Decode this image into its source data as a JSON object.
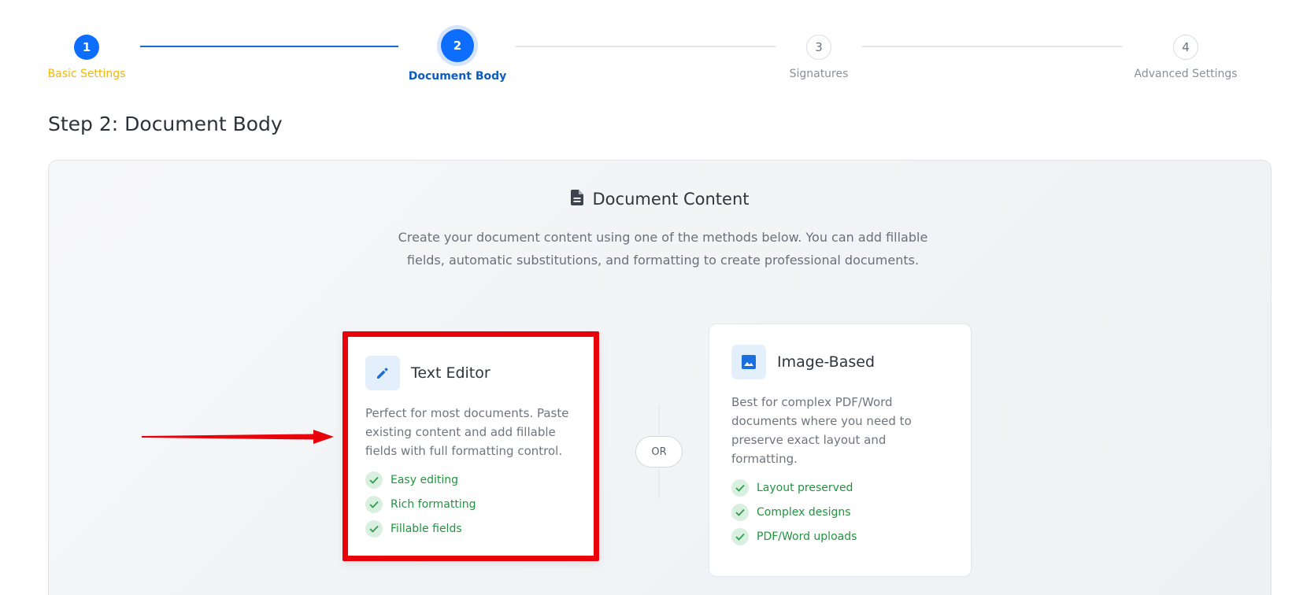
{
  "stepper": {
    "steps": [
      {
        "number": "1",
        "label": "Basic Settings",
        "state": "done"
      },
      {
        "number": "2",
        "label": "Document Body",
        "state": "active"
      },
      {
        "number": "3",
        "label": "Signatures",
        "state": "todo"
      },
      {
        "number": "4",
        "label": "Advanced Settings",
        "state": "todo"
      }
    ]
  },
  "page": {
    "title": "Step 2: Document Body"
  },
  "panel": {
    "title": "Document Content",
    "description": "Create your document content using one of the methods below. You can add fillable fields, automatic substitutions, and formatting to create professional documents."
  },
  "options": {
    "text_editor": {
      "title": "Text Editor",
      "icon": "pencil-icon",
      "description": "Perfect for most documents. Paste existing content and add fillable fields with full formatting control.",
      "features": [
        "Easy editing",
        "Rich formatting",
        "Fillable fields"
      ]
    },
    "divider_label": "OR",
    "image_based": {
      "title": "Image-Based",
      "icon": "image-icon",
      "description": "Best for complex PDF/Word documents where you need to preserve exact layout and formatting.",
      "features": [
        "Layout preserved",
        "Complex designs",
        "PDF/Word uploads"
      ]
    }
  },
  "colors": {
    "primary": "#0d6efd",
    "done_label": "#f2b705",
    "highlight_border": "#e8000a",
    "success": "#20943f"
  }
}
